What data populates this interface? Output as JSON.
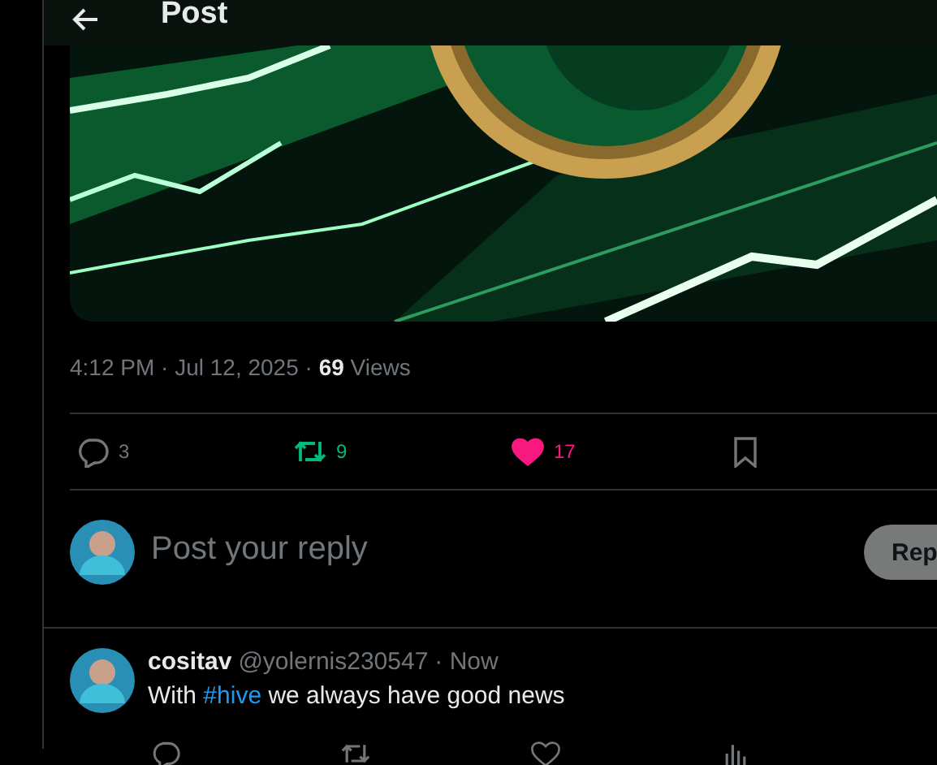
{
  "header": {
    "title": "Post"
  },
  "post": {
    "time": "4:12 PM · Jul 12, 2025 · ",
    "views_count": "69",
    "views_label": "Views",
    "actions": [
      {
        "kind": "reply",
        "count": "3",
        "active": false
      },
      {
        "kind": "repost",
        "count": "9",
        "active": true
      },
      {
        "kind": "like",
        "count": "17",
        "active": true
      },
      {
        "kind": "bookmark",
        "active": false
      }
    ]
  },
  "composer": {
    "placeholder": "Post your reply",
    "button": "Rep"
  },
  "replies": [
    {
      "name": "cositav",
      "handle": "@yolernis230547",
      "time": "· Now",
      "text_before": "With ",
      "hashtag": "#hive",
      "text_after": " we always have good news"
    }
  ]
}
